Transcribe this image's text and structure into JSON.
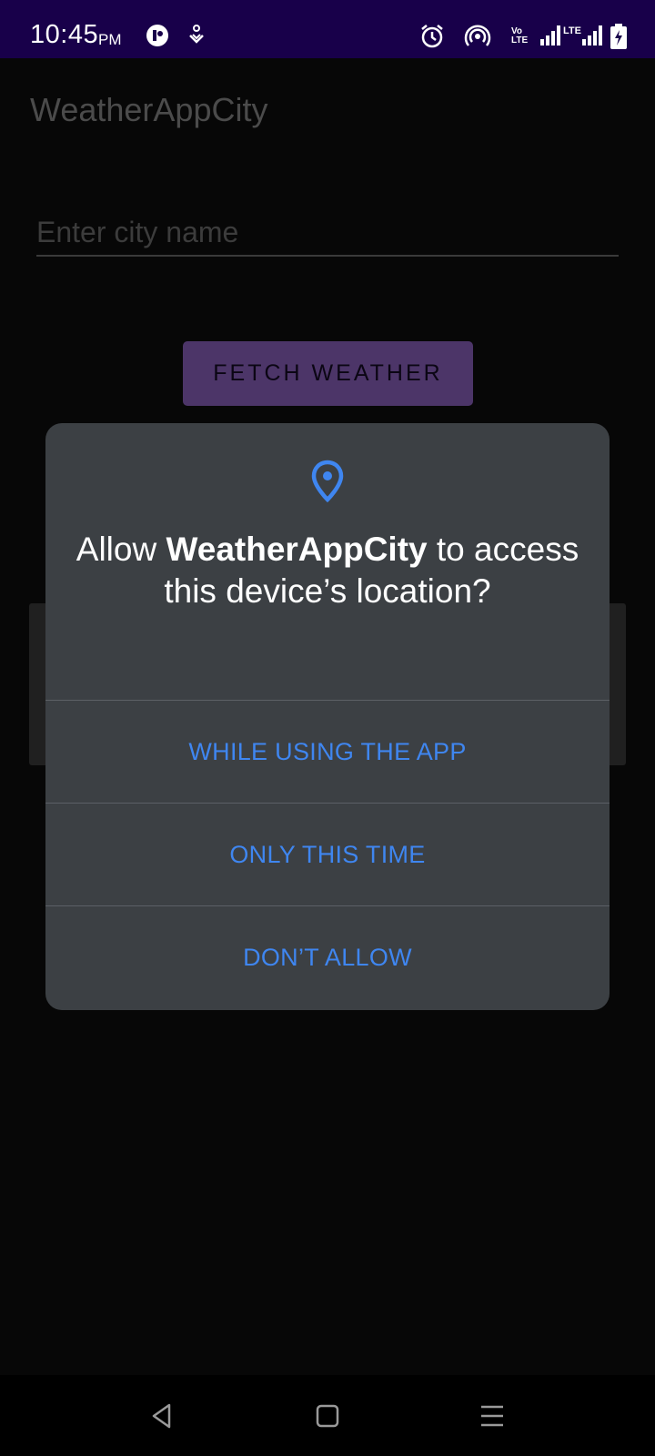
{
  "status_bar": {
    "time": "10:45",
    "ampm": "PM",
    "icons": [
      "app-notification-icon",
      "location-share-icon",
      "alarm-icon",
      "hotspot-icon",
      "volte-icon",
      "signal-icon",
      "lte-icon",
      "signal-icon-2",
      "battery-charging-icon"
    ],
    "volte_text": "Vo LTE",
    "lte_text": "LTE"
  },
  "app": {
    "title": "WeatherAppCity",
    "city_input": {
      "value": "",
      "placeholder": "Enter city name"
    },
    "fetch_button_label": "FETCH WEATHER"
  },
  "dialog": {
    "icon": "location-pin-icon",
    "message_prefix": "Allow ",
    "app_name": "WeatherAppCity",
    "message_suffix": " to access this device’s location?",
    "options": [
      {
        "label": "WHILE USING THE APP"
      },
      {
        "label": "ONLY THIS TIME"
      },
      {
        "label": "DON’T ALLOW"
      }
    ]
  },
  "nav_bar": {
    "buttons": [
      "back-icon",
      "home-icon",
      "menu-icon"
    ]
  },
  "colors": {
    "status_bar": "#18004a",
    "background": "#070707",
    "dialog_bg": "#3c4044",
    "accent_blue": "#3f86f0",
    "button_bg": "#4c3568"
  }
}
